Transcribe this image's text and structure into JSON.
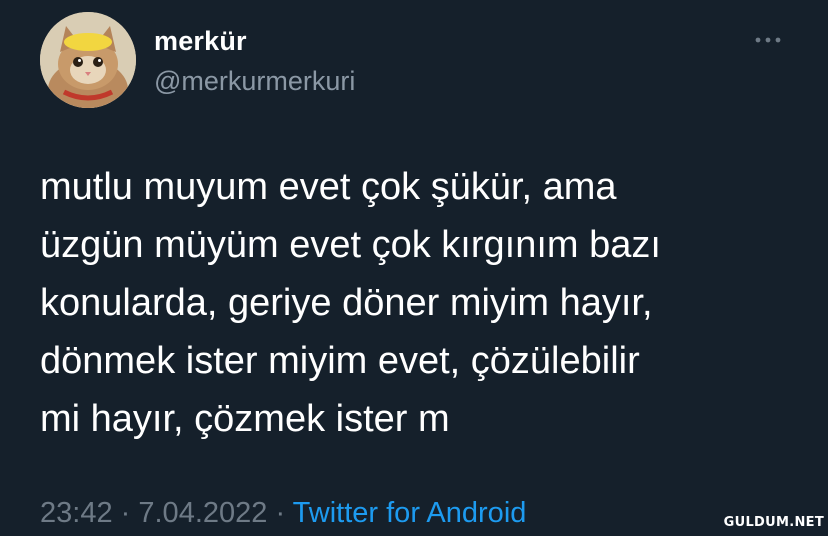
{
  "tweet": {
    "author": {
      "display_name": "merkür",
      "handle": "@merkurmerkuri"
    },
    "text": "mutlu muyum evet çok şükür, ama\nüzgün müyüm evet çok kırgınım bazı\nkonularda, geriye döner miyim hayır,\ndönmek ister miyim evet, çözülebilir\nmi hayır, çözmek ister m",
    "time": "23:42",
    "separator": "·",
    "date": "7.04.2022",
    "source": "Twitter for Android"
  },
  "icons": {
    "more": "more-horizontal-icon",
    "avatar": "kitten-avatar"
  },
  "watermark": "GULDUM.NET",
  "colors": {
    "background": "#15202b",
    "text_primary": "#ffffff",
    "text_secondary": "#8b98a5",
    "link": "#1d9bf0"
  }
}
